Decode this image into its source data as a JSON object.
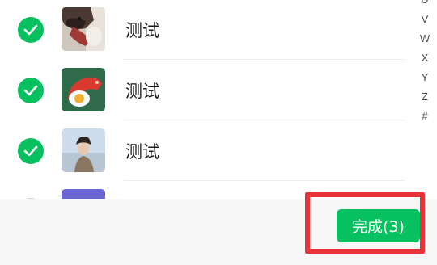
{
  "contacts": [
    {
      "name": "测试",
      "selected": true,
      "avatar": "dog-photo-avatar"
    },
    {
      "name": "测试",
      "selected": true,
      "avatar": "egg-illustration-avatar"
    },
    {
      "name": "测试",
      "selected": true,
      "avatar": "person-beach-avatar"
    },
    {
      "name": "",
      "selected": false,
      "avatar": "purple-avatar"
    }
  ],
  "index_letters": [
    "U",
    "V",
    "W",
    "X",
    "Y",
    "Z",
    "#"
  ],
  "done_button": {
    "label": "完成(3)"
  },
  "colors": {
    "accent": "#07c160",
    "highlight": "#e8333a",
    "bar": "#f6f6f6"
  }
}
